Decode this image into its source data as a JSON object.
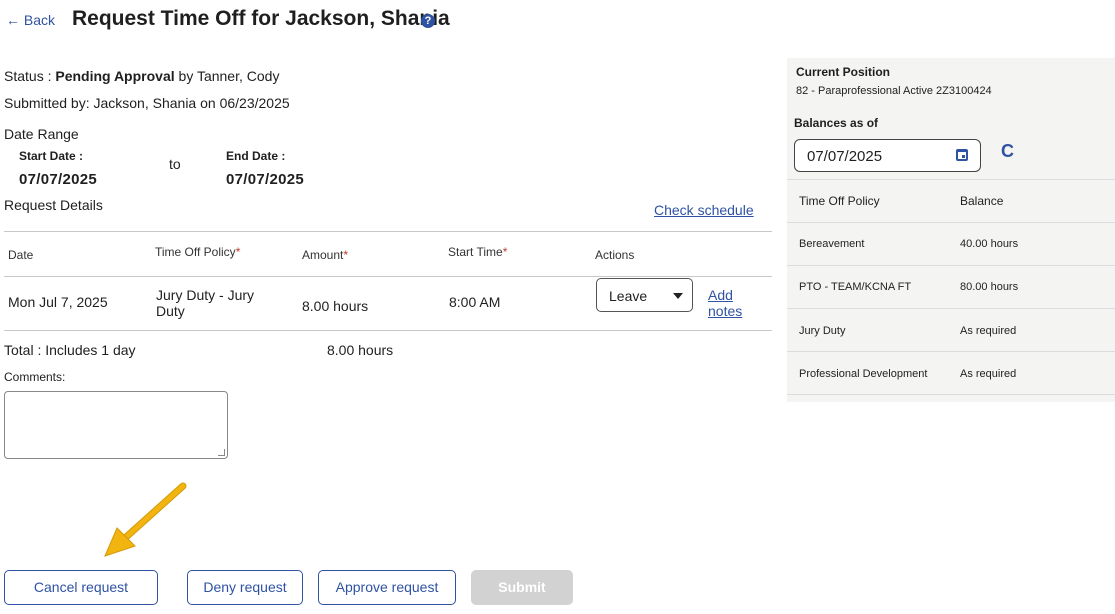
{
  "header": {
    "back_label": "← Back",
    "title": "Request Time Off for Jackson, Shania",
    "help_glyph": "?"
  },
  "status": {
    "prefix": "Status : ",
    "value": "Pending Approval",
    "by": " by Tanner, Cody"
  },
  "submitted": "Submitted by: Jackson, Shania on 06/23/2025",
  "date_range": {
    "label": "Date Range",
    "start_label": "Start Date :",
    "start_value": "07/07/2025",
    "to": "to",
    "end_label": "End Date :",
    "end_value": "07/07/2025"
  },
  "request_details": {
    "label": "Request Details",
    "check_schedule": "Check schedule"
  },
  "table": {
    "headers": {
      "date": "Date",
      "policy": "Time Off Policy",
      "amount": "Amount",
      "start_time": "Start Time",
      "actions": "Actions",
      "required_mark": "*"
    },
    "rows": [
      {
        "date": "Mon Jul 7, 2025",
        "policy_line1": "Jury Duty - Jury",
        "policy_line2": "Duty",
        "amount": "8.00 hours",
        "start_time": "8:00 AM",
        "action_selected": "Leave",
        "add_notes_line1": "Add",
        "add_notes_line2": "notes"
      }
    ]
  },
  "total": {
    "label": "Total : Includes 1 day",
    "amount": "8.00 hours"
  },
  "comments": {
    "label": "Comments:",
    "value": ""
  },
  "buttons": {
    "cancel": "Cancel request",
    "deny": "Deny request",
    "approve": "Approve request",
    "submit": "Submit"
  },
  "side_panel": {
    "current_position_label": "Current Position",
    "current_position_value": "82 - Paraprofessional Active 2Z3100424",
    "balances_label": "Balances as of",
    "balances_date": "07/07/2025",
    "refresh_glyph": "C",
    "col_policy": "Time Off Policy",
    "col_balance": "Balance",
    "rows": [
      {
        "policy": "Bereavement",
        "balance": "40.00 hours"
      },
      {
        "policy": "PTO - TEAM/KCNA FT",
        "balance": "80.00 hours"
      },
      {
        "policy": "Jury Duty",
        "balance": "As required"
      },
      {
        "policy": "Professional Development",
        "balance": "As required"
      }
    ]
  },
  "colors": {
    "accent": "#2f52a3",
    "required": "#c0392b",
    "arrow": "#f2b40f",
    "panel_bg": "#f4f4f2",
    "disabled_btn": "#d2d2d2"
  },
  "icons": {
    "back": "left-arrow-icon",
    "help": "help-circle-icon",
    "select_caret": "chevron-down-icon",
    "calendar": "calendar-icon",
    "refresh": "refresh-icon",
    "annotation_arrow": "annotation-arrow-icon"
  }
}
